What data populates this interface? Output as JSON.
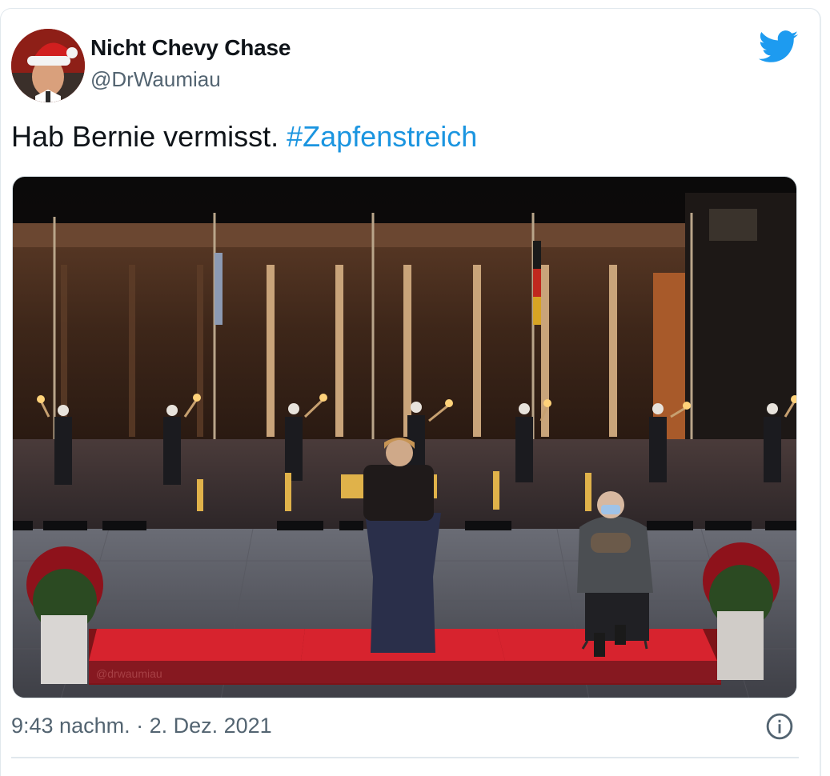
{
  "tweet": {
    "author": {
      "display_name": "Nicht Chevy Chase",
      "handle": "@DrWaumiau",
      "avatar_icon": "santa-hat-avatar"
    },
    "text": "Hab Bernie vermisst.",
    "hashtag": "#Zapfenstreich",
    "media": {
      "watermark": "@drwaumiau"
    },
    "timestamp": "9:43 nachm. · 2. Dez. 2021",
    "info_icon": "info-icon",
    "brand_icon": "twitter-bird-icon"
  },
  "colors": {
    "hashtag": "#1b95e0",
    "twitter_blue": "#1d9bf0",
    "text": "#0f1419",
    "secondary": "#536471"
  }
}
